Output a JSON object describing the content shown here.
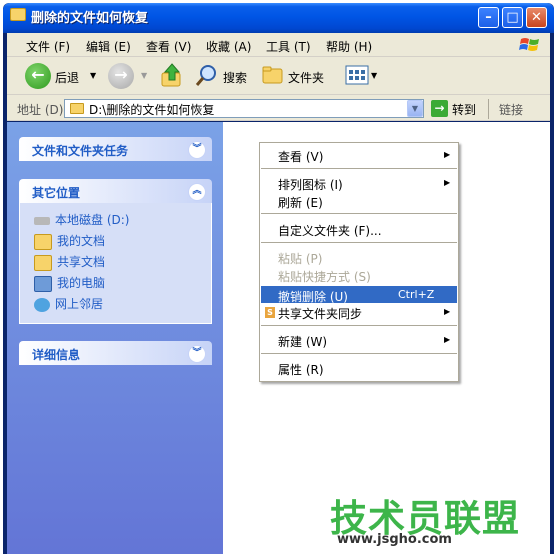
{
  "window": {
    "title": "删除的文件如何恢复",
    "minimize_glyph": "–",
    "maximize_glyph": "□",
    "close_glyph": "✕"
  },
  "menubar": [
    "文件 (F)",
    "编辑 (E)",
    "查看 (V)",
    "收藏 (A)",
    "工具 (T)",
    "帮助 (H)"
  ],
  "toolbar": {
    "back": "后退",
    "search": "搜索",
    "folders": "文件夹"
  },
  "address": {
    "label": "地址 (D)",
    "path": "D:\\删除的文件如何恢复",
    "go": "转到",
    "links": "链接"
  },
  "taskpane": {
    "file_tasks": "文件和文件夹任务",
    "other_places": {
      "title": "其它位置",
      "items": [
        "本地磁盘  (D:)",
        "我的文档",
        "共享文档",
        "我的电脑",
        "网上邻居"
      ]
    },
    "details": "详细信息"
  },
  "context_menu": {
    "view": "查看 (V)",
    "arrange": "排列图标 (I)",
    "refresh": "刷新 (E)",
    "customize": "自定义文件夹 (F)...",
    "paste": "粘贴 (P)",
    "paste_shortcut": "粘贴快捷方式 (S)",
    "undo_delete": "撤销删除 (U)",
    "undo_shortcut": "Ctrl+Z",
    "share_sync": "共享文件夹同步",
    "new": "新建 (W)",
    "properties": "属性 (R)"
  },
  "watermark": {
    "brand": "技术员联盟",
    "url": "www.jsgho.com"
  },
  "colors": {
    "title_blue": "#0055E5",
    "taskpane_blue": "#6375D6",
    "highlight": "#316AC5",
    "watermark_green": "#3DB54A"
  }
}
